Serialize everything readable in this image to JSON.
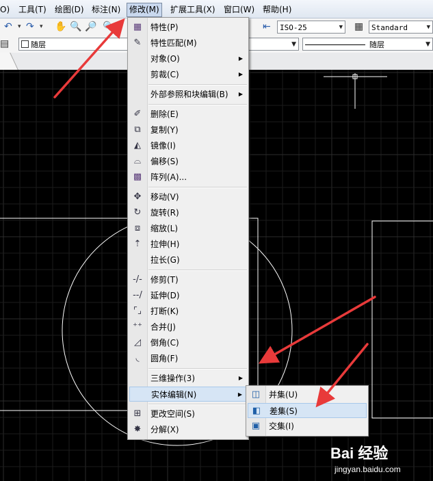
{
  "menubar": {
    "items": [
      {
        "label": "O)"
      },
      {
        "label": "工具(T)"
      },
      {
        "label": "绘图(D)"
      },
      {
        "label": "标注(N)"
      },
      {
        "label": "修改(M)"
      },
      {
        "label": "扩展工具(X)"
      },
      {
        "label": "窗口(W)"
      },
      {
        "label": "帮助(H)"
      }
    ],
    "active_index": 4
  },
  "toolbar": {
    "dim_style": "ISO-25",
    "table_style": "Standard",
    "layer": "随层",
    "linetype": "随层"
  },
  "modify_menu": {
    "items": [
      {
        "type": "item",
        "label": "特性(P)",
        "icon": "properties-icon"
      },
      {
        "type": "item",
        "label": "特性匹配(M)",
        "icon": "match-properties-icon"
      },
      {
        "type": "item",
        "label": "对象(O)",
        "submenu": true
      },
      {
        "type": "item",
        "label": "剪裁(C)",
        "submenu": true
      },
      {
        "type": "sep"
      },
      {
        "type": "item",
        "label": "外部参照和块编辑(B)",
        "submenu": true
      },
      {
        "type": "sep"
      },
      {
        "type": "item",
        "label": "删除(E)",
        "icon": "erase-icon"
      },
      {
        "type": "item",
        "label": "复制(Y)",
        "icon": "copy-icon"
      },
      {
        "type": "item",
        "label": "镜像(I)",
        "icon": "mirror-icon"
      },
      {
        "type": "item",
        "label": "偏移(S)",
        "icon": "offset-icon"
      },
      {
        "type": "item",
        "label": "阵列(A)...",
        "icon": "array-icon"
      },
      {
        "type": "sep"
      },
      {
        "type": "item",
        "label": "移动(V)",
        "icon": "move-icon"
      },
      {
        "type": "item",
        "label": "旋转(R)",
        "icon": "rotate-icon"
      },
      {
        "type": "item",
        "label": "缩放(L)",
        "icon": "scale-icon"
      },
      {
        "type": "item",
        "label": "拉伸(H)",
        "icon": "stretch-icon"
      },
      {
        "type": "item",
        "label": "拉长(G)"
      },
      {
        "type": "sep"
      },
      {
        "type": "item",
        "label": "修剪(T)",
        "icon": "trim-icon"
      },
      {
        "type": "item",
        "label": "延伸(D)",
        "icon": "extend-icon"
      },
      {
        "type": "item",
        "label": "打断(K)",
        "icon": "break-icon"
      },
      {
        "type": "item",
        "label": "合并(J)",
        "icon": "join-icon"
      },
      {
        "type": "item",
        "label": "倒角(C)",
        "icon": "chamfer-icon"
      },
      {
        "type": "item",
        "label": "圆角(F)",
        "icon": "fillet-icon"
      },
      {
        "type": "sep"
      },
      {
        "type": "item",
        "label": "三维操作(3)",
        "submenu": true
      },
      {
        "type": "item",
        "label": "实体编辑(N)",
        "submenu": true,
        "highlighted": true
      },
      {
        "type": "sep"
      },
      {
        "type": "item",
        "label": "更改空间(S)",
        "icon": "change-space-icon"
      },
      {
        "type": "item",
        "label": "分解(X)",
        "icon": "explode-icon"
      }
    ]
  },
  "solid_edit_menu": {
    "items": [
      {
        "label": "并集(U)",
        "icon": "union-icon"
      },
      {
        "label": "差集(S)",
        "icon": "subtract-icon",
        "highlighted": true
      },
      {
        "label": "交集(I)",
        "icon": "intersect-icon"
      }
    ]
  },
  "watermark": {
    "logo": "Bai 经验",
    "url": "jingyan.baidu.com"
  },
  "colors": {
    "canvas": "#000000",
    "grid": "#1c1c1c",
    "annotation_arrow": "#e83a3a",
    "highlight": "#d6e5f5"
  }
}
